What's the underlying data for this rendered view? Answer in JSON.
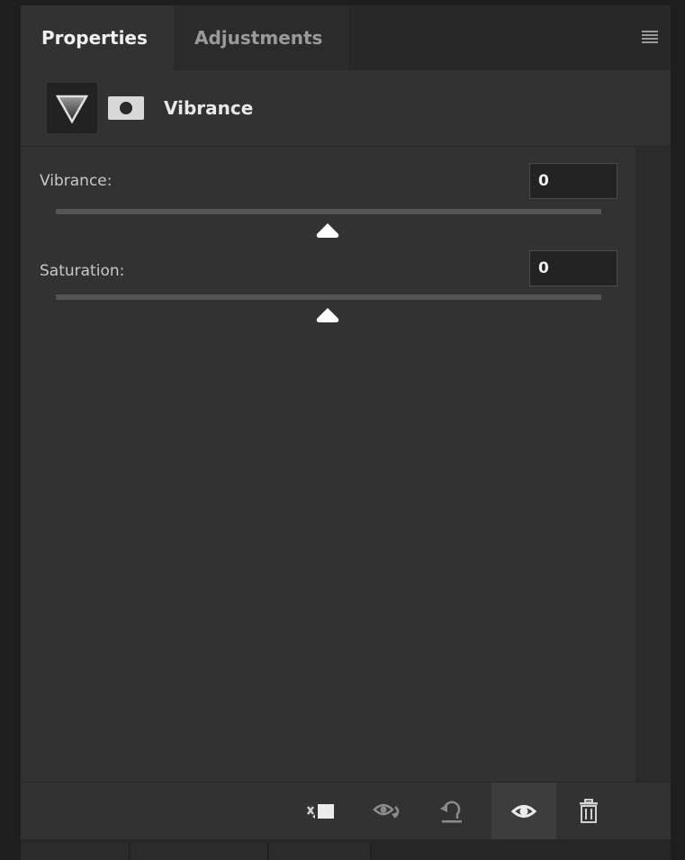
{
  "tabs": {
    "properties": "Properties",
    "adjustments": "Adjustments"
  },
  "header": {
    "title": "Vibrance",
    "adjustment_icon": "vibrance-triangle-icon",
    "mask_icon": "layer-mask-icon"
  },
  "controls": {
    "vibrance": {
      "label": "Vibrance:",
      "value": "0",
      "slider_position": 0.5
    },
    "saturation": {
      "label": "Saturation:",
      "value": "0",
      "slider_position": 0.5
    }
  },
  "footer": {
    "icons": [
      "clip-to-layer-icon",
      "view-previous-state-icon",
      "reset-icon",
      "toggle-visibility-icon",
      "delete-icon"
    ],
    "active_icon": "toggle-visibility-icon"
  },
  "colors": {
    "panel_bg": "#323232",
    "tab_active_text": "#f0f0f0",
    "tab_inactive_text": "#9a9a9a",
    "label_text": "#c8c8c8"
  }
}
